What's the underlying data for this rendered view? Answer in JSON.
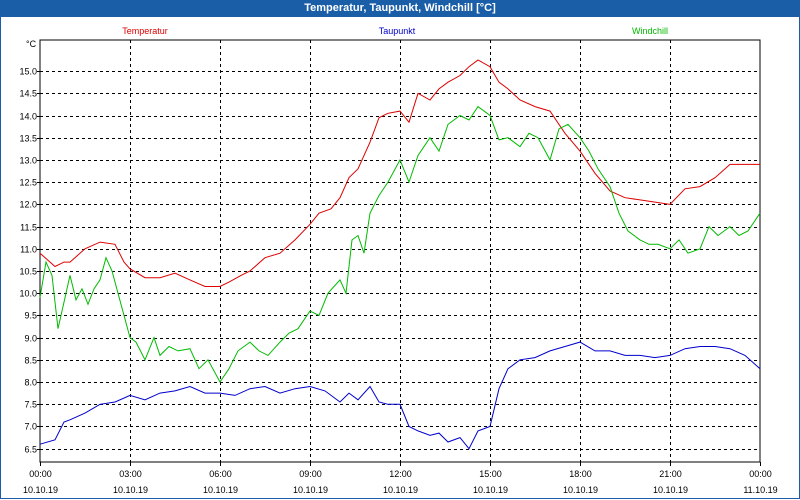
{
  "window": {
    "title": "Temperatur, Taupunkt, Windchill [°C]"
  },
  "chart_data": {
    "type": "line",
    "title": "Temperatur, Taupunkt, Windchill [°C]",
    "ylabel": "°C",
    "ylim": [
      6.2,
      15.7
    ],
    "yticks": [
      "6.5",
      "7.0",
      "7.5",
      "8.0",
      "8.5",
      "9.0",
      "9.5",
      "10.0",
      "10.5",
      "11.0",
      "11.5",
      "12.0",
      "12.5",
      "13.0",
      "13.5",
      "14.0",
      "14.5",
      "15.0"
    ],
    "xlim": [
      0,
      24
    ],
    "xticks": [
      {
        "time": "00:00",
        "date": "10.10.19"
      },
      {
        "time": "03:00",
        "date": "10.10.19"
      },
      {
        "time": "06:00",
        "date": "10.10.19"
      },
      {
        "time": "09:00",
        "date": "10.10.19"
      },
      {
        "time": "12:00",
        "date": "10.10.19"
      },
      {
        "time": "15:00",
        "date": "10.10.19"
      },
      {
        "time": "18:00",
        "date": "10.10.19"
      },
      {
        "time": "21:00",
        "date": "10.10.19"
      },
      {
        "time": "00:00",
        "date": "11.10.19"
      }
    ],
    "grid": true,
    "series": [
      {
        "name": "Temperatur",
        "color": "#dd0000",
        "x": [
          0,
          0.5,
          0.8,
          1,
          1.5,
          2,
          2.5,
          2.8,
          3,
          3.5,
          4,
          4.5,
          5,
          5.5,
          6,
          6.3,
          6.7,
          7,
          7.5,
          8,
          8.5,
          9,
          9.3,
          9.7,
          10,
          10.3,
          10.6,
          11,
          11.3,
          11.6,
          12,
          12.3,
          12.6,
          13,
          13.3,
          13.6,
          14,
          14.3,
          14.6,
          15,
          15.3,
          15.6,
          16,
          16.5,
          17,
          17.5,
          18,
          18.5,
          19,
          19.5,
          20,
          20.5,
          21,
          21.5,
          22,
          22.5,
          23,
          23.5,
          24
        ],
        "values": [
          10.9,
          10.6,
          10.7,
          10.7,
          11.0,
          11.15,
          11.1,
          10.7,
          10.55,
          10.35,
          10.35,
          10.45,
          10.3,
          10.15,
          10.15,
          10.25,
          10.4,
          10.5,
          10.8,
          10.9,
          11.2,
          11.55,
          11.8,
          11.9,
          12.15,
          12.6,
          12.8,
          13.4,
          13.95,
          14.05,
          14.1,
          13.85,
          14.5,
          14.35,
          14.6,
          14.75,
          14.9,
          15.1,
          15.25,
          15.1,
          14.75,
          14.6,
          14.35,
          14.2,
          14.1,
          13.6,
          13.2,
          12.7,
          12.3,
          12.15,
          12.1,
          12.05,
          12.0,
          12.35,
          12.4,
          12.6,
          12.9,
          12.9,
          12.9
        ]
      },
      {
        "name": "Taupunkt",
        "color": "#0000cc",
        "x": [
          0,
          0.5,
          0.8,
          1,
          1.5,
          2,
          2.5,
          3,
          3.5,
          4,
          4.5,
          5,
          5.5,
          6,
          6.5,
          7,
          7.5,
          8,
          8.5,
          9,
          9.5,
          10,
          10.3,
          10.6,
          11,
          11.3,
          11.6,
          12,
          12.3,
          12.6,
          13,
          13.3,
          13.6,
          14,
          14.3,
          14.6,
          15,
          15.3,
          15.6,
          16,
          16.5,
          17,
          17.5,
          18,
          18.5,
          19,
          19.5,
          20,
          20.5,
          21,
          21.5,
          22,
          22.5,
          23,
          23.5,
          24
        ],
        "values": [
          6.6,
          6.7,
          7.1,
          7.15,
          7.3,
          7.5,
          7.55,
          7.7,
          7.6,
          7.75,
          7.8,
          7.9,
          7.75,
          7.75,
          7.7,
          7.85,
          7.9,
          7.75,
          7.85,
          7.9,
          7.8,
          7.55,
          7.75,
          7.6,
          7.9,
          7.55,
          7.5,
          7.5,
          7.0,
          6.9,
          6.8,
          6.85,
          6.65,
          6.75,
          6.5,
          6.9,
          7.0,
          7.85,
          8.3,
          8.5,
          8.55,
          8.7,
          8.8,
          8.9,
          8.7,
          8.7,
          8.6,
          8.6,
          8.55,
          8.6,
          8.75,
          8.8,
          8.8,
          8.75,
          8.6,
          8.3
        ]
      },
      {
        "name": "Windchill",
        "color": "#00bb00",
        "x": [
          0,
          0.2,
          0.4,
          0.6,
          0.8,
          1,
          1.2,
          1.4,
          1.6,
          1.8,
          2,
          2.2,
          2.4,
          2.6,
          2.8,
          3,
          3.2,
          3.5,
          3.8,
          4,
          4.3,
          4.6,
          5,
          5.3,
          5.6,
          6,
          6.3,
          6.6,
          7,
          7.3,
          7.6,
          8,
          8.3,
          8.6,
          9,
          9.3,
          9.6,
          10,
          10.2,
          10.4,
          10.6,
          10.8,
          11,
          11.3,
          11.6,
          12,
          12.3,
          12.6,
          13,
          13.3,
          13.6,
          14,
          14.3,
          14.6,
          15,
          15.3,
          15.6,
          16,
          16.3,
          16.6,
          17,
          17.3,
          17.6,
          18,
          18.3,
          18.6,
          19,
          19.3,
          19.6,
          20,
          20.3,
          20.6,
          21,
          21.3,
          21.6,
          22,
          22.3,
          22.6,
          23,
          23.3,
          23.6,
          24
        ],
        "values": [
          9.9,
          10.7,
          10.4,
          9.2,
          9.8,
          10.4,
          9.85,
          10.1,
          9.75,
          10.1,
          10.3,
          10.8,
          10.5,
          10.0,
          9.5,
          9.0,
          8.9,
          8.5,
          9.0,
          8.6,
          8.8,
          8.7,
          8.75,
          8.3,
          8.5,
          8.0,
          8.3,
          8.7,
          8.9,
          8.7,
          8.6,
          8.9,
          9.1,
          9.2,
          9.6,
          9.5,
          10.0,
          10.3,
          10.0,
          11.2,
          11.3,
          10.9,
          11.8,
          12.2,
          12.5,
          13.0,
          12.5,
          13.1,
          13.5,
          13.2,
          13.8,
          14.0,
          13.9,
          14.2,
          14.0,
          13.45,
          13.5,
          13.3,
          13.6,
          13.5,
          13.0,
          13.7,
          13.8,
          13.5,
          13.2,
          12.8,
          12.4,
          11.8,
          11.4,
          11.2,
          11.1,
          11.1,
          11.0,
          11.2,
          10.9,
          11.0,
          11.5,
          11.3,
          11.5,
          11.3,
          11.4,
          11.8
        ]
      }
    ]
  }
}
